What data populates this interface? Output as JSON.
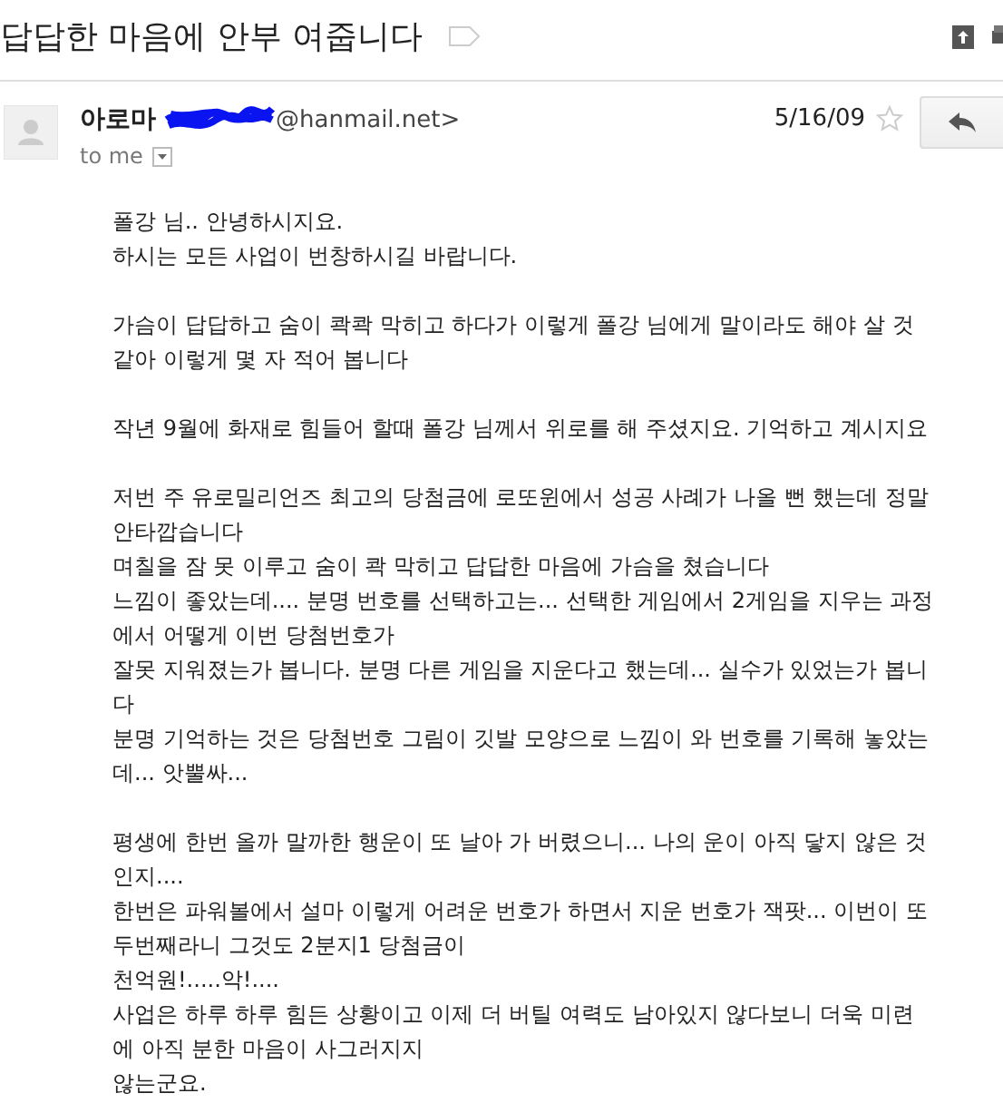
{
  "subject": "답답한 마음에 안부 여줍니다",
  "sender": {
    "name": "아로마",
    "email": "@hanmail.net>",
    "redacted": true
  },
  "recipient": "to me",
  "date": "5/16/09",
  "starred": false,
  "paragraphs": [
    [
      "폴강 님.. 안녕하시지요.",
      "하시는 모든 사업이 번창하시길 바랍니다."
    ],
    [
      "가슴이 답답하고 숨이 콱콱 막히고 하다가 이렇게 폴강 님에게 말이라도 해야 살 것",
      "같아 이렇게 몇 자 적어 봅니다"
    ],
    [
      "작년 9월에 화재로 힘들어 할때 폴강 님께서 위로를 해 주셨지요. 기억하고 계시지요"
    ],
    [
      "저번 주 유로밀리언즈 최고의 당첨금에 로또윈에서 성공 사례가 나올 뻔 했는데 정말",
      "안타깝습니다",
      "며칠을 잠 못 이루고 숨이 콱 막히고 답답한 마음에 가슴을 쳤습니다",
      "느낌이 좋았는데.... 분명 번호를 선택하고는... 선택한 게임에서 2게임을 지우는 과정",
      "에서 어떻게 이번 당첨번호가",
      "잘못 지워졌는가 봅니다. 분명 다른 게임을 지운다고 했는데... 실수가 있었는가 봅니",
      "다",
      "분명 기억하는 것은 당첨번호 그림이 깃발 모양으로 느낌이 와 번호를 기록해 놓았는",
      "데... 앗뿔싸..."
    ],
    [
      "평생에 한번 올까 말까한 행운이 또 날아 가 버렸으니... 나의 운이 아직 닿지 않은 것",
      "인지....",
      "한번은 파워볼에서 설마 이렇게 어려운 번호가 하면서 지운 번호가 잭팟... 이번이 또",
      "두번째라니 그것도 2분지1 당첨금이",
      "천억원!.....악!....",
      "사업은 하루 하루 힘든 상황이고 이제 더 버틸 여력도 남아있지 않다보니 더욱 미련",
      "에 아직 분한 마음이 사그러지지",
      "않는군요."
    ]
  ]
}
